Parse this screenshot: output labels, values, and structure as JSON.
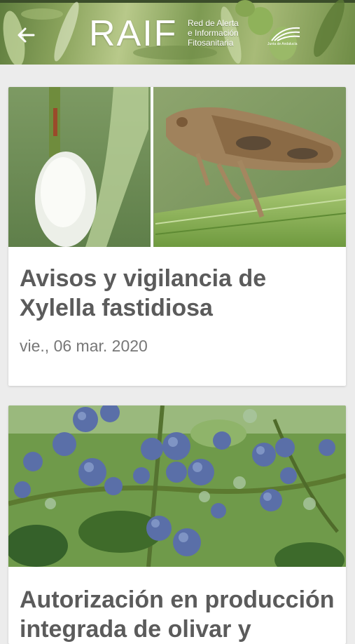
{
  "header": {
    "logo_text": "RAIF",
    "subtitle_lines": [
      "Red de Alerta",
      "e Información",
      "Fitosanitaria"
    ],
    "gov_logo_text": "Junta de Andalucía"
  },
  "articles": [
    {
      "title": "Avisos y vigilancia de Xylella fastidiosa",
      "date": "vie., 06 mar. 2020"
    },
    {
      "title": "Autorización en producción integrada de olivar y"
    }
  ],
  "colors": {
    "header_green": "#7d9a52",
    "title_gray": "#5b5b5b",
    "date_gray": "#777777",
    "background": "#ececec"
  }
}
